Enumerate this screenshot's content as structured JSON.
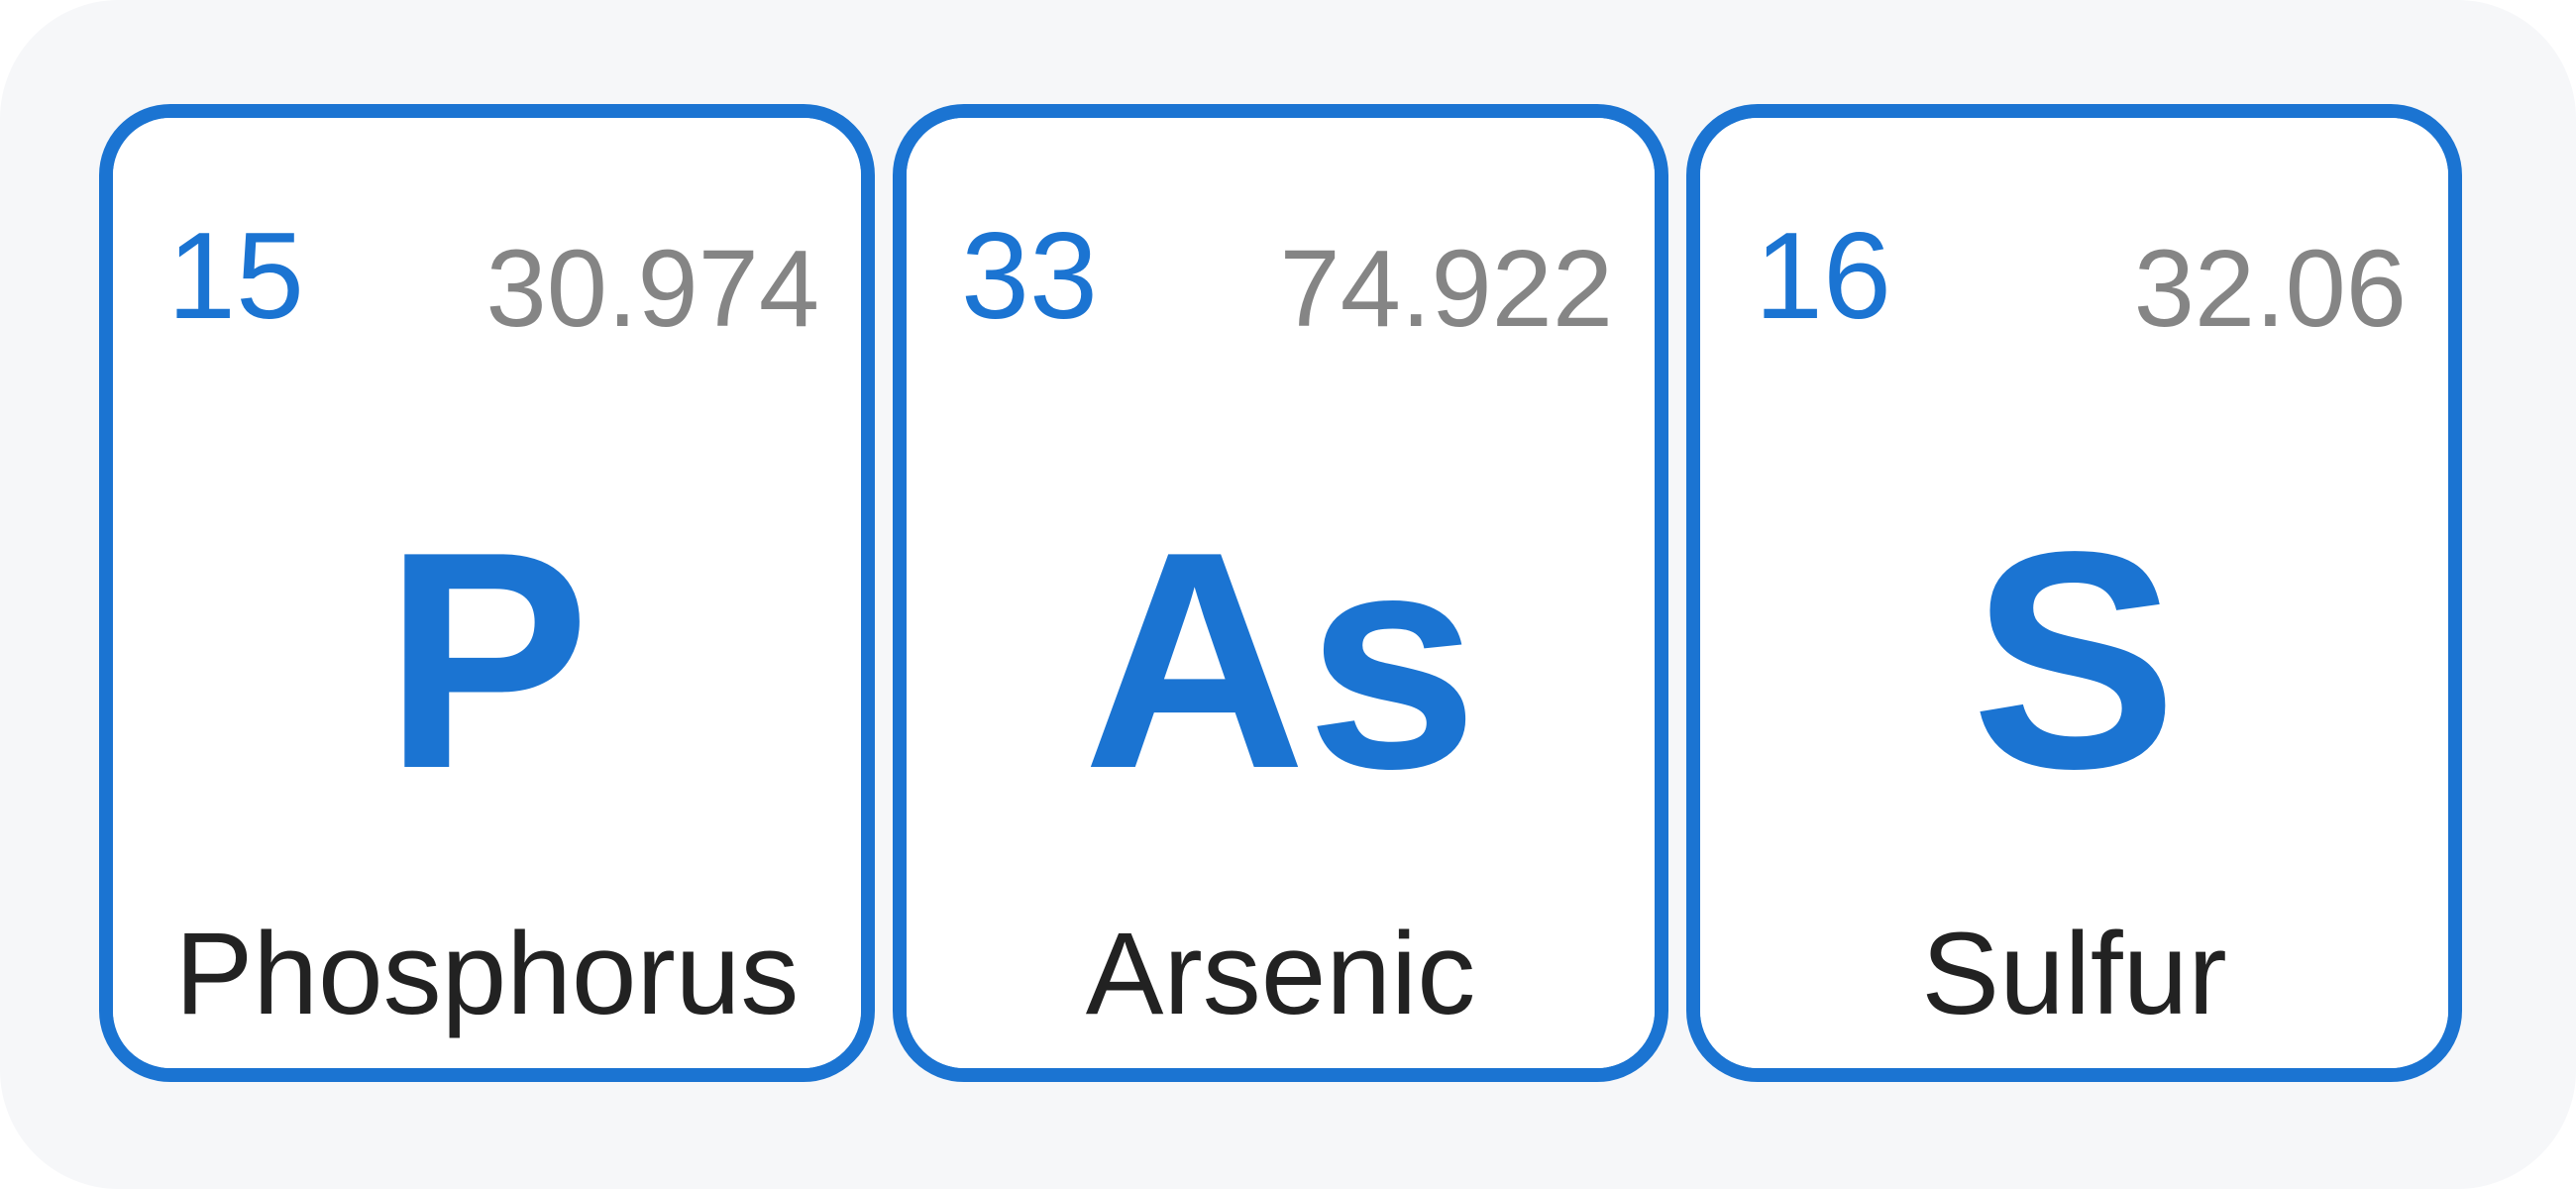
{
  "colors": {
    "accent": "#1b74d2",
    "mass_text": "#858585",
    "name_text": "#222222",
    "background": "#f6f7f9",
    "tile_background": "#ffffff"
  },
  "elements": [
    {
      "atomic_number": "15",
      "atomic_mass": "30.974",
      "symbol": "P",
      "name": "Phosphorus"
    },
    {
      "atomic_number": "33",
      "atomic_mass": "74.922",
      "symbol": "As",
      "name": "Arsenic"
    },
    {
      "atomic_number": "16",
      "atomic_mass": "32.06",
      "symbol": "S",
      "name": "Sulfur"
    }
  ]
}
